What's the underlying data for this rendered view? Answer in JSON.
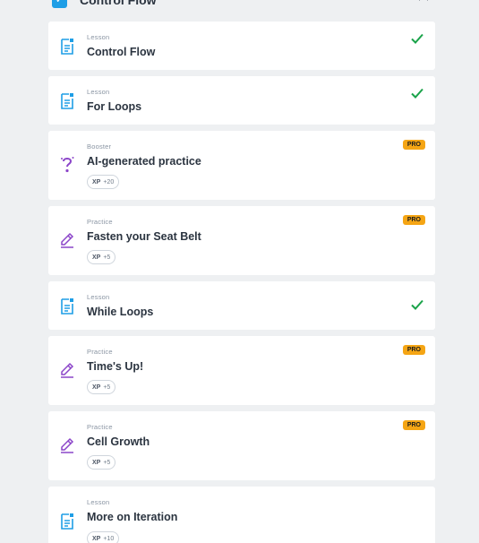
{
  "section": {
    "title": "Control Flow"
  },
  "cards": [
    {
      "type": "Lesson",
      "title": "Control Flow",
      "status": "completed",
      "icon": "lesson-icon"
    },
    {
      "type": "Lesson",
      "title": "For Loops",
      "status": "completed",
      "icon": "lesson-icon"
    },
    {
      "type": "Booster",
      "title": "AI-generated practice",
      "pro": "PRO",
      "xp_label": "XP",
      "xp_value": "+20",
      "icon": "question-icon"
    },
    {
      "type": "Practice",
      "title": "Fasten your Seat Belt",
      "pro": "PRO",
      "xp_label": "XP",
      "xp_value": "+5",
      "icon": "pencil-icon"
    },
    {
      "type": "Lesson",
      "title": "While Loops",
      "status": "completed",
      "icon": "lesson-icon"
    },
    {
      "type": "Practice",
      "title": "Time's Up!",
      "pro": "PRO",
      "xp_label": "XP",
      "xp_value": "+5",
      "icon": "pencil-icon"
    },
    {
      "type": "Practice",
      "title": "Cell Growth",
      "pro": "PRO",
      "xp_label": "XP",
      "xp_value": "+5",
      "icon": "pencil-icon"
    },
    {
      "type": "Lesson",
      "title": "More on Iteration",
      "xp_label": "XP",
      "xp_value": "+10",
      "icon": "lesson-icon"
    }
  ],
  "colors": {
    "lesson_icon": "#1e9ee6",
    "practice_icon": "#8b45c9",
    "check": "#1aa34a",
    "pro_badge": "#f5a514",
    "background": "#eef0f2"
  }
}
